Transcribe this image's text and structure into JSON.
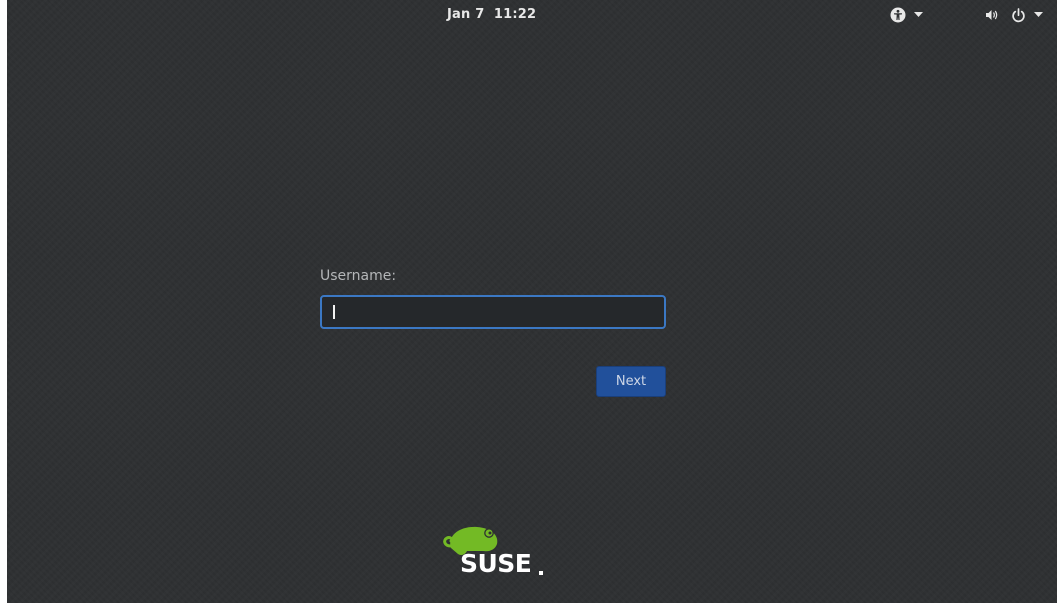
{
  "topbar": {
    "clock": "Jan 7  11:22",
    "accessibility_icon": "accessibility-icon",
    "volume_icon": "volume-icon",
    "power_icon": "power-icon",
    "dropdown_icon": "chevron-down-icon"
  },
  "login": {
    "username_label": "Username:",
    "username_value": "",
    "next_label": "Next"
  },
  "branding": {
    "logo_text": "SUSE",
    "logo_icon": "suse-chameleon-icon",
    "logo_green": "#73ba25"
  },
  "colors": {
    "background": "#2e3032",
    "input_focus_border": "#3b78c4",
    "button_accent": "#21509b"
  }
}
